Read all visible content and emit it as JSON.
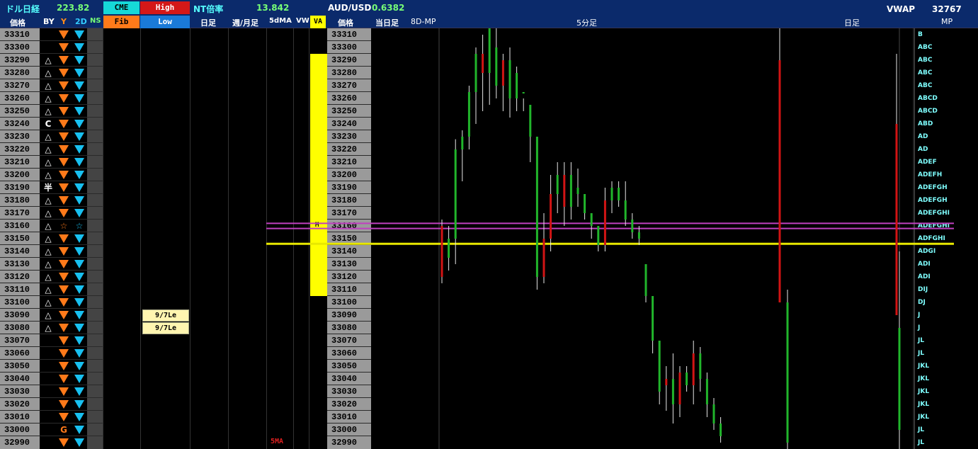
{
  "header": {
    "nikkei_dollar_label": "ドル日経",
    "nikkei_dollar_value": "223.82",
    "cme_button": "CME",
    "high_button": "High",
    "fib_button": "Fib",
    "low_button": "Low",
    "nt_label": "NT倍率",
    "nt_value": "13.842",
    "audusd_label": "AUD/USD",
    "audusd_value": "0.6382",
    "vwap_label": "VWAP",
    "vwap_value": "32767"
  },
  "columns": {
    "price": "価格",
    "by": "BY",
    "y": "Y",
    "d2": "2D",
    "ns": "NS",
    "daily": "日足",
    "weekly_monthly": "週/月足",
    "ma5": "5dMA",
    "vw": "VW",
    "va": "VA",
    "price2": "価格",
    "today": "当日足",
    "mp8d": "8D-MP",
    "min5": "5分足",
    "daily2": "日足",
    "mp": "MP"
  },
  "prices": [
    "33310",
    "33300",
    "33290",
    "33280",
    "33270",
    "33260",
    "33250",
    "33240",
    "33230",
    "33220",
    "33210",
    "33200",
    "33190",
    "33180",
    "33170",
    "33160",
    "33150",
    "33140",
    "33130",
    "33120",
    "33110",
    "33100",
    "33090",
    "33080",
    "33070",
    "33060",
    "33050",
    "33040",
    "33030",
    "33020",
    "33010",
    "33000",
    "32990"
  ],
  "by_symbols": [
    "",
    "",
    "△",
    "△",
    "△",
    "△",
    "△",
    "C",
    "△",
    "△",
    "△",
    "△",
    "半",
    "△",
    "△",
    "△",
    "△",
    "△",
    "△",
    "△",
    "△",
    "△",
    "△",
    "△",
    "",
    "",
    "",
    "",
    "",
    "",
    "",
    "",
    ""
  ],
  "y_special": {
    "15": "☆",
    "31": "G"
  },
  "d2_special": {
    "15": "☆"
  },
  "mp_letters": [
    "B",
    "ABC",
    "ABC",
    "ABC",
    "ABC",
    "ABCD",
    "ABCD",
    "ABD",
    "AD",
    "AD",
    "ADEF",
    "ADEFH",
    "ADEFGH",
    "ADEFGH",
    "ADEFGHI",
    "ADEFGHI",
    "ADFGHI",
    "ADGI",
    "ADI",
    "ADI",
    "DIJ",
    "DJ",
    "J",
    "J",
    "JL",
    "JL",
    "JKL",
    "JKL",
    "JKL",
    "JKL",
    "JKL",
    "JL",
    "JL"
  ],
  "daily_labels": [
    {
      "row": 22,
      "text": "9/7Le"
    },
    {
      "row": 23,
      "text": "9/7Le"
    }
  ],
  "ma5_label": "5MA",
  "va_marker": "M",
  "colors": {
    "header_bg": "#0b2a6b",
    "up": "#21b52b",
    "down": "#d21414",
    "va": "#ffff00",
    "line_magenta": "#c040c0",
    "line_yellow": "#e8e800"
  },
  "chart_data": {
    "type": "candlestick",
    "title": "5分足",
    "ylim": [
      32985,
      33315
    ],
    "va_range": [
      33105,
      33295
    ],
    "horizontal_lines": [
      33162,
      33158,
      33146
    ],
    "candles": [
      {
        "o": 33160,
        "h": 33165,
        "l": 33115,
        "c": 33120,
        "up": false
      },
      {
        "o": 33135,
        "h": 33160,
        "l": 33125,
        "c": 33150,
        "up": true
      },
      {
        "o": 33150,
        "h": 33228,
        "l": 33130,
        "c": 33220,
        "up": true
      },
      {
        "o": 33220,
        "h": 33235,
        "l": 33195,
        "c": 33230,
        "up": true
      },
      {
        "o": 33230,
        "h": 33270,
        "l": 33220,
        "c": 33265,
        "up": true
      },
      {
        "o": 33265,
        "h": 33300,
        "l": 33240,
        "c": 33295,
        "up": true
      },
      {
        "o": 33295,
        "h": 33310,
        "l": 33250,
        "c": 33280,
        "up": false
      },
      {
        "o": 33280,
        "h": 33315,
        "l": 33255,
        "c": 33315,
        "up": true
      },
      {
        "o": 33300,
        "h": 33315,
        "l": 33260,
        "c": 33270,
        "up": true
      },
      {
        "o": 33270,
        "h": 33295,
        "l": 33250,
        "c": 33290,
        "up": false
      },
      {
        "o": 33290,
        "h": 33300,
        "l": 33245,
        "c": 33260,
        "up": true
      },
      {
        "o": 33260,
        "h": 33285,
        "l": 33250,
        "c": 33280,
        "up": true
      },
      {
        "o": 33265,
        "h": 33260,
        "l": 33250,
        "c": 33265,
        "up": true
      },
      {
        "o": 33255,
        "h": 33240,
        "l": 33210,
        "c": 33230,
        "up": true
      },
      {
        "o": 33230,
        "h": 33215,
        "l": 33110,
        "c": 33120,
        "up": true
      },
      {
        "o": 33120,
        "h": 33170,
        "l": 33115,
        "c": 33150,
        "up": false
      },
      {
        "o": 33150,
        "h": 33200,
        "l": 33140,
        "c": 33185,
        "up": false
      },
      {
        "o": 33185,
        "h": 33210,
        "l": 33170,
        "c": 33200,
        "up": true
      },
      {
        "o": 33200,
        "h": 33210,
        "l": 33160,
        "c": 33175,
        "up": false
      },
      {
        "o": 33175,
        "h": 33210,
        "l": 33165,
        "c": 33200,
        "up": true
      },
      {
        "o": 33190,
        "h": 33205,
        "l": 33175,
        "c": 33185,
        "up": true
      },
      {
        "o": 33185,
        "h": 33185,
        "l": 33165,
        "c": 33170,
        "up": true
      },
      {
        "o": 33170,
        "h": 33170,
        "l": 33150,
        "c": 33160,
        "up": true
      },
      {
        "o": 33160,
        "h": 33160,
        "l": 33140,
        "c": 33145,
        "up": true
      },
      {
        "o": 33145,
        "h": 33190,
        "l": 33140,
        "c": 33180,
        "up": false
      },
      {
        "o": 33180,
        "h": 33195,
        "l": 33170,
        "c": 33190,
        "up": true
      },
      {
        "o": 33190,
        "h": 33195,
        "l": 33175,
        "c": 33180,
        "up": true
      },
      {
        "o": 33180,
        "h": 33195,
        "l": 33160,
        "c": 33165,
        "up": true
      },
      {
        "o": 33165,
        "h": 33170,
        "l": 33150,
        "c": 33155,
        "up": true
      },
      {
        "o": 33155,
        "h": 33160,
        "l": 33145,
        "c": 33150,
        "up": true
      },
      {
        "o": 33130,
        "h": 33125,
        "l": 33100,
        "c": 33105,
        "up": true
      },
      {
        "o": 33105,
        "h": 33100,
        "l": 33060,
        "c": 33070,
        "up": true
      },
      {
        "o": 33070,
        "h": 33060,
        "l": 33020,
        "c": 33030,
        "up": true
      },
      {
        "o": 33035,
        "h": 33050,
        "l": 33015,
        "c": 33040,
        "up": false
      },
      {
        "o": 33040,
        "h": 33060,
        "l": 33005,
        "c": 33020,
        "up": true
      },
      {
        "o": 33020,
        "h": 33050,
        "l": 33010,
        "c": 33045,
        "up": false
      },
      {
        "o": 33045,
        "h": 33050,
        "l": 33030,
        "c": 33035,
        "up": true
      },
      {
        "o": 33035,
        "h": 33070,
        "l": 33020,
        "c": 33060,
        "up": false
      },
      {
        "o": 33060,
        "h": 33065,
        "l": 33030,
        "c": 33040,
        "up": true
      },
      {
        "o": 33040,
        "h": 33045,
        "l": 33010,
        "c": 33020,
        "up": true
      },
      {
        "o": 33020,
        "h": 33025,
        "l": 33000,
        "c": 33005,
        "up": true
      },
      {
        "o": 33005,
        "h": 33010,
        "l": 32990,
        "c": 32995,
        "up": true
      }
    ],
    "daily_candles": [
      {
        "o": 33100,
        "h": 33315,
        "l": 33100,
        "c": 33290,
        "up": false
      },
      {
        "o": 33100,
        "h": 33110,
        "l": 32985,
        "c": 32990,
        "up": true
      },
      {
        "o": 33240,
        "h": 33295,
        "l": 33090,
        "c": 33090,
        "up": false
      },
      {
        "o": 33080,
        "h": 33140,
        "l": 32985,
        "c": 33000,
        "up": true
      }
    ]
  }
}
